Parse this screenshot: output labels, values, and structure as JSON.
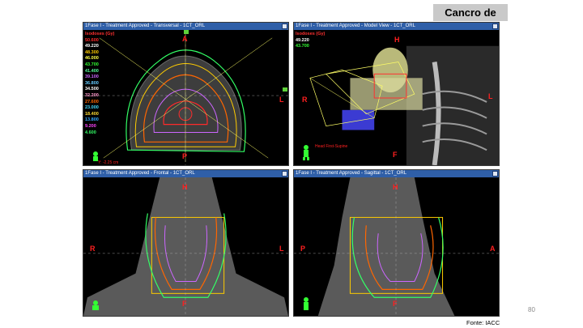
{
  "slide": {
    "title": "Cancro de ORL",
    "page_number": "80",
    "source": "Fonte: IACC"
  },
  "panels": {
    "transversal": {
      "title": "1Fase I - Treatment Approved - Transversal - 1CT_ORL",
      "legend_header": "Isodoses (Gy)",
      "legend": [
        {
          "value": "50.600",
          "color": "#ff2a2a"
        },
        {
          "value": "49.220",
          "color": "#ffffff"
        },
        {
          "value": "48.300",
          "color": "#ffcc00"
        },
        {
          "value": "46.000",
          "color": "#ffff44"
        },
        {
          "value": "43.700",
          "color": "#33ff33"
        },
        {
          "value": "41.400",
          "color": "#55ff99"
        },
        {
          "value": "39.100",
          "color": "#cc66ff"
        },
        {
          "value": "36.800",
          "color": "#66ccff"
        },
        {
          "value": "34.500",
          "color": "#ffffff"
        },
        {
          "value": "32.200",
          "color": "#ff99cc"
        },
        {
          "value": "27.600",
          "color": "#ff6600"
        },
        {
          "value": "23.000",
          "color": "#44ddff"
        },
        {
          "value": "18.400",
          "color": "#ffdd33"
        },
        {
          "value": "13.800",
          "color": "#33aaff"
        },
        {
          "value": "9.200",
          "color": "#ff44ff"
        },
        {
          "value": "4.600",
          "color": "#33ff66"
        }
      ],
      "orient": {
        "top": "A",
        "bottom": "P",
        "left": "",
        "right": "L"
      },
      "slice_pos": "Y: -2.25 cm"
    },
    "model_view": {
      "title": "1Fase I - Treatment Approved - Model View - 1CT_ORL",
      "dose_header": "Isodoses (Gy)",
      "dose_lines": [
        "49.220",
        "43.700"
      ],
      "orient": {
        "top": "H",
        "right": "L",
        "left": "R",
        "bottom": "F"
      },
      "position_text": "Head First-Supine"
    },
    "frontal": {
      "title": "1Fase I - Treatment Approved - Frontal - 1CT_ORL",
      "orient": {
        "top": "H",
        "left": "R",
        "right": "L",
        "bottom": "F"
      }
    },
    "sagittal": {
      "title": "1Fase I - Treatment Approved - Sagittal - 1CT_ORL",
      "orient": {
        "top": "H",
        "left": "P",
        "right": "A",
        "bottom": "F"
      }
    }
  }
}
